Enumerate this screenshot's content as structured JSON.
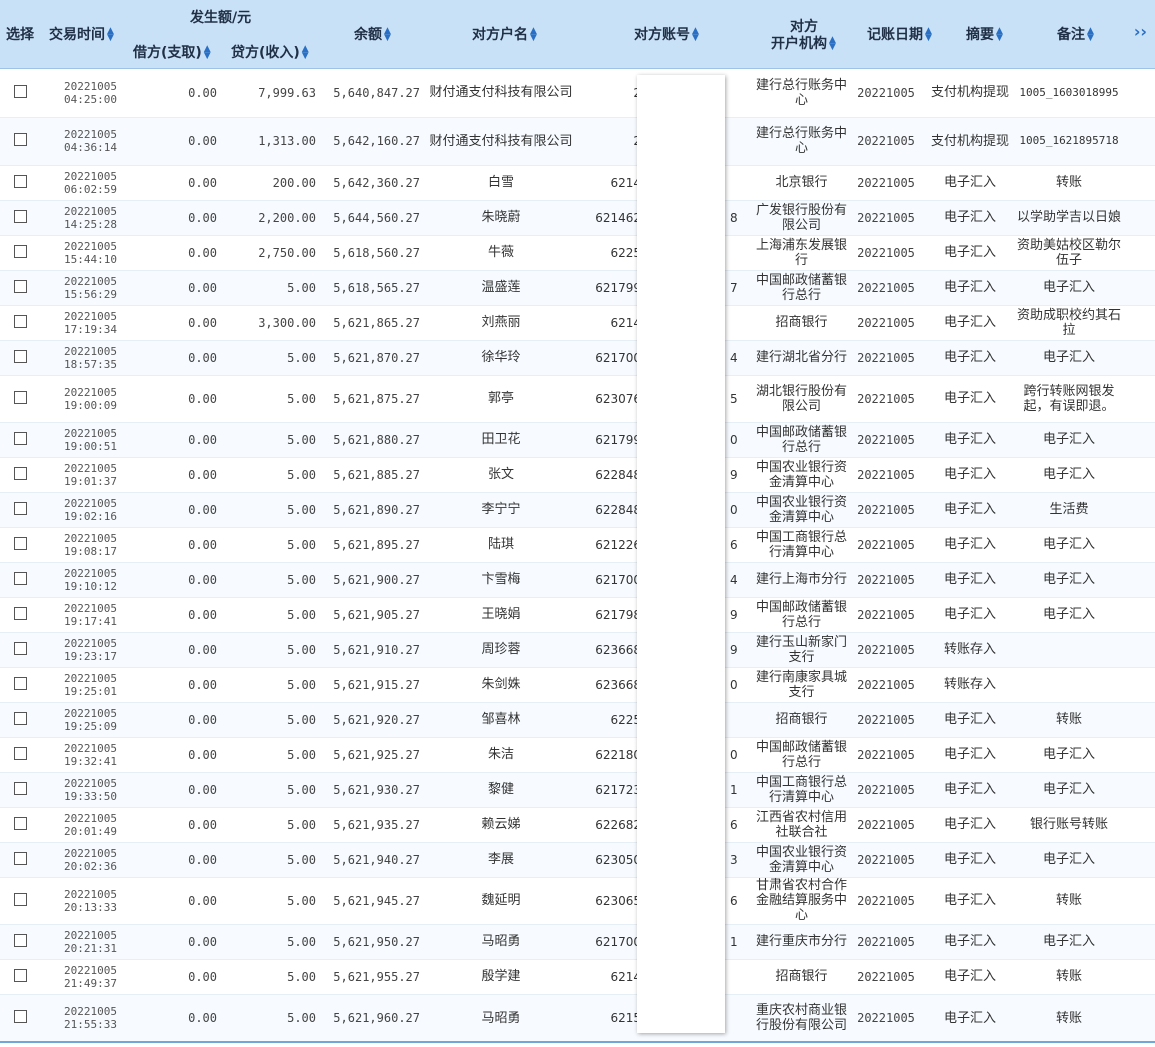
{
  "header": {
    "select": "选择",
    "time": "交易时间",
    "amount_group": "发生额/元",
    "debit": "借方(支取)",
    "credit": "贷方(收入)",
    "balance": "余额",
    "party_name": "对方户名",
    "party_account": "对方账号",
    "party_bank_line1": "对方",
    "party_bank_line2": "开户机构",
    "book_date": "记账日期",
    "summary": "摘要",
    "remark": "备注",
    "more": "››"
  },
  "rows": [
    {
      "date": "20221005",
      "time": "04:25:00",
      "debit": "0.00",
      "credit": "7,999.63",
      "balance": "5,640,847.27",
      "name": "财付通支付科技有限公司",
      "acct": "2",
      "bank": "建行总行账务中心",
      "book": "20221005",
      "summary": "支付机构提现",
      "remark": "1005_1603018995"
    },
    {
      "date": "20221005",
      "time": "04:36:14",
      "debit": "0.00",
      "credit": "1,313.00",
      "balance": "5,642,160.27",
      "name": "财付通支付科技有限公司",
      "acct": "2",
      "bank": "建行总行账务中心",
      "book": "20221005",
      "summary": "支付机构提现",
      "remark": "1005_1621895718"
    },
    {
      "date": "20221005",
      "time": "06:02:59",
      "debit": "0.00",
      "credit": "200.00",
      "balance": "5,642,360.27",
      "name": "白雪",
      "acct": "6214",
      "bank": "北京银行",
      "book": "20221005",
      "summary": "电子汇入",
      "remark": "转账"
    },
    {
      "date": "20221005",
      "time": "14:25:28",
      "debit": "0.00",
      "credit": "2,200.00",
      "balance": "5,644,560.27",
      "name": "朱晓蔚",
      "acct": "621462",
      "acct_tail": "8",
      "bank": "广发银行股份有限公司",
      "book": "20221005",
      "summary": "电子汇入",
      "remark": "以学助学吉以日娘"
    },
    {
      "date": "20221005",
      "time": "15:44:10",
      "debit": "0.00",
      "credit": "2,750.00",
      "balance": "5,618,560.27",
      "name": "牛薇",
      "acct": "6225",
      "bank": "上海浦东发展银行",
      "book": "20221005",
      "summary": "电子汇入",
      "remark": "资助美姑校区勒尔伍子"
    },
    {
      "date": "20221005",
      "time": "15:56:29",
      "debit": "0.00",
      "credit": "5.00",
      "balance": "5,618,565.27",
      "name": "温盛莲",
      "acct": "621799",
      "acct_tail": "7",
      "bank": "中国邮政储蓄银行总行",
      "book": "20221005",
      "summary": "电子汇入",
      "remark": "电子汇入"
    },
    {
      "date": "20221005",
      "time": "17:19:34",
      "debit": "0.00",
      "credit": "3,300.00",
      "balance": "5,621,865.27",
      "name": "刘燕丽",
      "acct": "6214",
      "bank": "招商银行",
      "book": "20221005",
      "summary": "电子汇入",
      "remark": "资助成职校约其石拉"
    },
    {
      "date": "20221005",
      "time": "18:57:35",
      "debit": "0.00",
      "credit": "5.00",
      "balance": "5,621,870.27",
      "name": "徐华玲",
      "acct": "621700",
      "acct_tail": "4",
      "bank": "建行湖北省分行",
      "book": "20221005",
      "summary": "电子汇入",
      "remark": "电子汇入"
    },
    {
      "date": "20221005",
      "time": "19:00:09",
      "debit": "0.00",
      "credit": "5.00",
      "balance": "5,621,875.27",
      "name": "郭亭",
      "acct": "623076",
      "acct_tail": "5",
      "bank": "湖北银行股份有限公司",
      "book": "20221005",
      "summary": "电子汇入",
      "remark": "跨行转账网银发起，有误即退。"
    },
    {
      "date": "20221005",
      "time": "19:00:51",
      "debit": "0.00",
      "credit": "5.00",
      "balance": "5,621,880.27",
      "name": "田卫花",
      "acct": "621799",
      "acct_tail": "0",
      "bank": "中国邮政储蓄银行总行",
      "book": "20221005",
      "summary": "电子汇入",
      "remark": "电子汇入"
    },
    {
      "date": "20221005",
      "time": "19:01:37",
      "debit": "0.00",
      "credit": "5.00",
      "balance": "5,621,885.27",
      "name": "张文",
      "acct": "622848",
      "acct_tail": "9",
      "bank": "中国农业银行资金清算中心",
      "book": "20221005",
      "summary": "电子汇入",
      "remark": "电子汇入"
    },
    {
      "date": "20221005",
      "time": "19:02:16",
      "debit": "0.00",
      "credit": "5.00",
      "balance": "5,621,890.27",
      "name": "李宁宁",
      "acct": "622848",
      "acct_tail": "0",
      "bank": "中国农业银行资金清算中心",
      "book": "20221005",
      "summary": "电子汇入",
      "remark": "生活费"
    },
    {
      "date": "20221005",
      "time": "19:08:17",
      "debit": "0.00",
      "credit": "5.00",
      "balance": "5,621,895.27",
      "name": "陆琪",
      "acct": "621226",
      "acct_tail": "6",
      "bank": "中国工商银行总行清算中心",
      "book": "20221005",
      "summary": "电子汇入",
      "remark": "电子汇入"
    },
    {
      "date": "20221005",
      "time": "19:10:12",
      "debit": "0.00",
      "credit": "5.00",
      "balance": "5,621,900.27",
      "name": "卞雪梅",
      "acct": "621700",
      "acct_tail": "4",
      "bank": "建行上海市分行",
      "book": "20221005",
      "summary": "电子汇入",
      "remark": "电子汇入"
    },
    {
      "date": "20221005",
      "time": "19:17:41",
      "debit": "0.00",
      "credit": "5.00",
      "balance": "5,621,905.27",
      "name": "王晓娟",
      "acct": "621798",
      "acct_tail": "9",
      "bank": "中国邮政储蓄银行总行",
      "book": "20221005",
      "summary": "电子汇入",
      "remark": "电子汇入"
    },
    {
      "date": "20221005",
      "time": "19:23:17",
      "debit": "0.00",
      "credit": "5.00",
      "balance": "5,621,910.27",
      "name": "周珍蓉",
      "acct": "623668",
      "acct_tail": "9",
      "bank": "建行玉山新家门支行",
      "book": "20221005",
      "summary": "转账存入",
      "remark": ""
    },
    {
      "date": "20221005",
      "time": "19:25:01",
      "debit": "0.00",
      "credit": "5.00",
      "balance": "5,621,915.27",
      "name": "朱剑姝",
      "acct": "623668",
      "acct_tail": "0",
      "bank": "建行南康家具城支行",
      "book": "20221005",
      "summary": "转账存入",
      "remark": ""
    },
    {
      "date": "20221005",
      "time": "19:25:09",
      "debit": "0.00",
      "credit": "5.00",
      "balance": "5,621,920.27",
      "name": "邹喜林",
      "acct": "6225",
      "bank": "招商银行",
      "book": "20221005",
      "summary": "电子汇入",
      "remark": "转账"
    },
    {
      "date": "20221005",
      "time": "19:32:41",
      "debit": "0.00",
      "credit": "5.00",
      "balance": "5,621,925.27",
      "name": "朱洁",
      "acct": "622180",
      "acct_tail": "0",
      "bank": "中国邮政储蓄银行总行",
      "book": "20221005",
      "summary": "电子汇入",
      "remark": "电子汇入"
    },
    {
      "date": "20221005",
      "time": "19:33:50",
      "debit": "0.00",
      "credit": "5.00",
      "balance": "5,621,930.27",
      "name": "黎健",
      "acct": "621723",
      "acct_tail": "1",
      "bank": "中国工商银行总行清算中心",
      "book": "20221005",
      "summary": "电子汇入",
      "remark": "电子汇入"
    },
    {
      "date": "20221005",
      "time": "20:01:49",
      "debit": "0.00",
      "credit": "5.00",
      "balance": "5,621,935.27",
      "name": "赖云娣",
      "acct": "622682",
      "acct_tail": "6",
      "bank": "江西省农村信用社联合社",
      "book": "20221005",
      "summary": "电子汇入",
      "remark": "银行账号转账"
    },
    {
      "date": "20221005",
      "time": "20:02:36",
      "debit": "0.00",
      "credit": "5.00",
      "balance": "5,621,940.27",
      "name": "李展",
      "acct": "623050",
      "acct_tail": "3",
      "bank": "中国农业银行资金清算中心",
      "book": "20221005",
      "summary": "电子汇入",
      "remark": "电子汇入"
    },
    {
      "date": "20221005",
      "time": "20:13:33",
      "debit": "0.00",
      "credit": "5.00",
      "balance": "5,621,945.27",
      "name": "魏延明",
      "acct": "623065",
      "acct_tail": "6",
      "bank": "甘肃省农村合作金融结算服务中心",
      "book": "20221005",
      "summary": "电子汇入",
      "remark": "转账"
    },
    {
      "date": "20221005",
      "time": "20:21:31",
      "debit": "0.00",
      "credit": "5.00",
      "balance": "5,621,950.27",
      "name": "马昭勇",
      "acct": "621700",
      "acct_tail": "1",
      "bank": "建行重庆市分行",
      "book": "20221005",
      "summary": "电子汇入",
      "remark": "电子汇入"
    },
    {
      "date": "20221005",
      "time": "21:49:37",
      "debit": "0.00",
      "credit": "5.00",
      "balance": "5,621,955.27",
      "name": "殷学建",
      "acct": "6214",
      "bank": "招商银行",
      "book": "20221005",
      "summary": "电子汇入",
      "remark": "转账"
    },
    {
      "date": "20221005",
      "time": "21:55:33",
      "debit": "0.00",
      "credit": "5.00",
      "balance": "5,621,960.27",
      "name": "马昭勇",
      "acct": "6215",
      "bank": "重庆农村商业银行股份有限公司",
      "book": "20221005",
      "summary": "电子汇入",
      "remark": "转账"
    }
  ]
}
